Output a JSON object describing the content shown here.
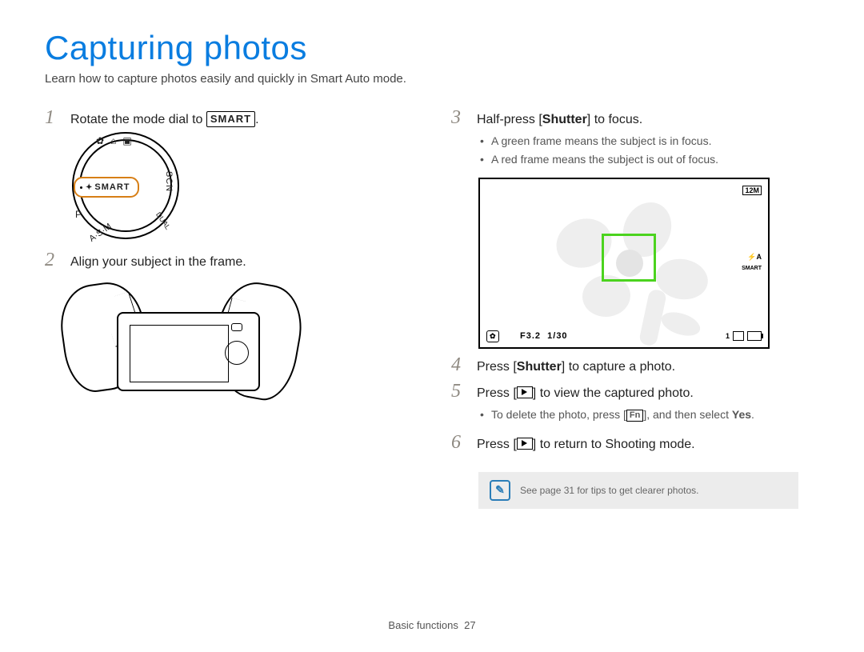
{
  "title": "Capturing photos",
  "subtitle": "Learn how to capture photos easily and quickly in Smart Auto mode.",
  "steps": {
    "s1": {
      "num": "1",
      "pre": "Rotate the mode dial to ",
      "smart": "SMART",
      "post": "."
    },
    "s2": {
      "num": "2",
      "text": "Align your subject in the frame."
    },
    "s3": {
      "num": "3",
      "pre": "Half-press [",
      "bold": "Shutter",
      "post": "] to focus.",
      "bullets": [
        "A green frame means the subject is in focus.",
        "A red frame means the subject is out of focus."
      ]
    },
    "s4": {
      "num": "4",
      "pre": "Press [",
      "bold": "Shutter",
      "post": "] to capture a photo."
    },
    "s5": {
      "num": "5",
      "pre": "Press [",
      "post": "] to view the captured photo.",
      "bullets_pre": "To delete the photo, press [",
      "bullets_fn": "Fn",
      "bullets_mid": "], and then select ",
      "bullets_bold": "Yes",
      "bullets_post": "."
    },
    "s6": {
      "num": "6",
      "pre": "Press [",
      "post": "] to return to Shooting mode."
    }
  },
  "dial": {
    "smart": "SMART",
    "scn": "SCN",
    "asm": "A·S·M",
    "dual": "DUAL",
    "p": "P"
  },
  "lcd": {
    "res": "12M",
    "smart_label": "SMART",
    "flash": "A",
    "aperture": "F3.2",
    "shutter": "1/30",
    "counter": "1",
    "flower_icon": "✿"
  },
  "note": {
    "text": "See page 31 for tips to get clearer photos."
  },
  "footer": {
    "section": "Basic functions",
    "page": "27"
  }
}
